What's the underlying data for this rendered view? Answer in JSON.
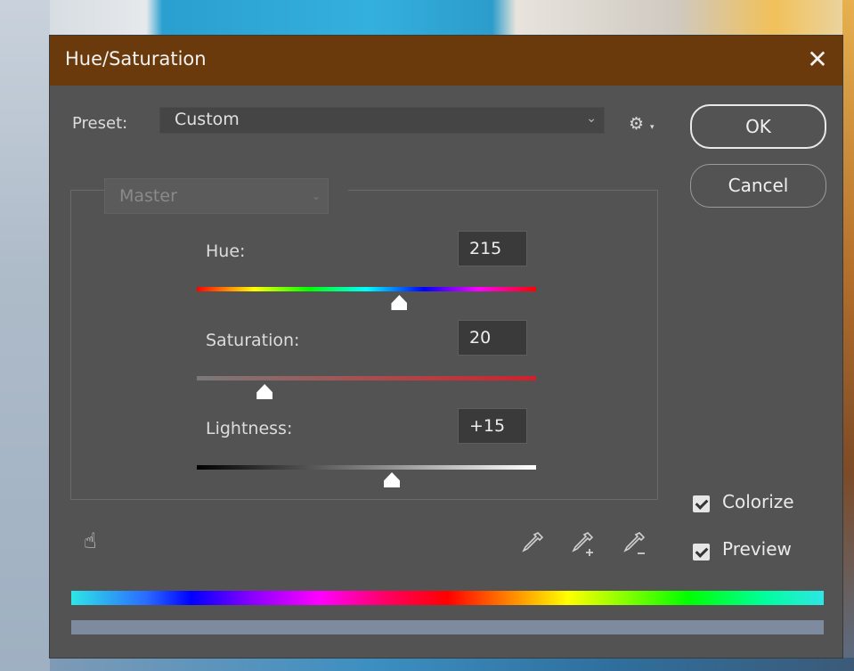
{
  "dialog": {
    "title": "Hue/Saturation",
    "close_glyph": "✕",
    "preset_label": "Preset:",
    "preset_value": "Custom",
    "edit_channel": "Master",
    "ok_label": "OK",
    "cancel_label": "Cancel"
  },
  "adjustments": {
    "hue": {
      "label": "Hue:",
      "value": "215",
      "slider_fraction": 0.597
    },
    "saturation": {
      "label": "Saturation:",
      "value": "20",
      "slider_fraction": 0.2
    },
    "lightness": {
      "label": "Lightness:",
      "value": "+15",
      "slider_fraction": 0.575
    }
  },
  "options": {
    "colorize": {
      "label": "Colorize",
      "checked": true
    },
    "preview": {
      "label": "Preview",
      "checked": true
    }
  },
  "icons": {
    "settings": "gear-icon",
    "on_image_adjust": "hand-pointer-icon",
    "eyedropper": "eyedropper-icon",
    "eyedropper_add": "eyedropper-add-icon",
    "eyedropper_subtract": "eyedropper-subtract-icon",
    "close": "close-icon"
  },
  "colors": {
    "title_bar": "#6b3a0c",
    "dialog_background": "#535353",
    "text": "#dcdcdc"
  }
}
